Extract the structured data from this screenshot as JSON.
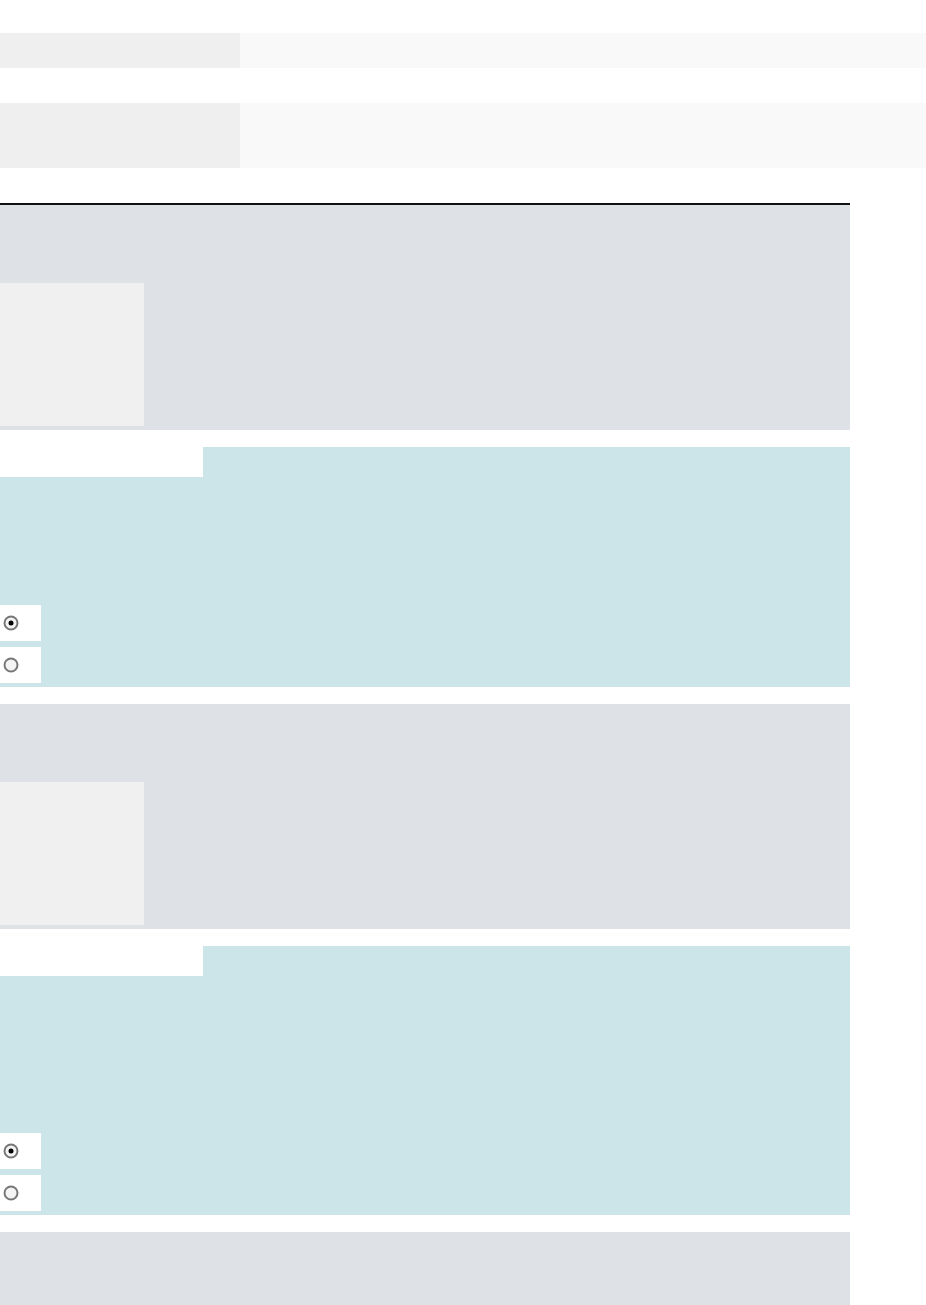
{
  "header_rows": [
    {
      "kind": "short"
    },
    {
      "kind": "tall"
    }
  ],
  "blocks": [
    {
      "kind": "prompt"
    },
    {
      "kind": "choice",
      "options": [
        {
          "selected": true
        },
        {
          "selected": false
        }
      ]
    },
    {
      "kind": "prompt"
    },
    {
      "kind": "choice",
      "options": [
        {
          "selected": true
        },
        {
          "selected": false
        }
      ]
    },
    {
      "kind": "prompt_cut"
    }
  ]
}
